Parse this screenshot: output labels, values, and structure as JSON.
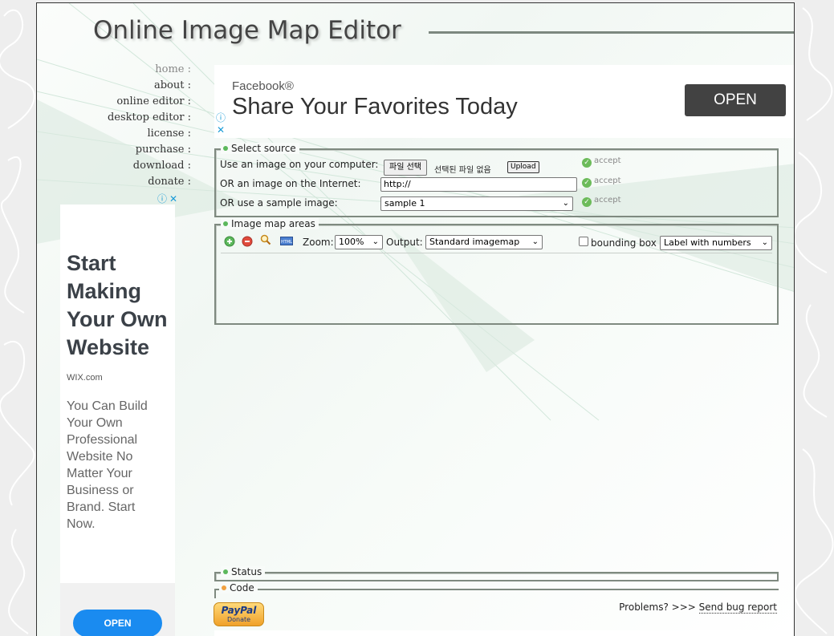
{
  "site": {
    "title": "Online Image Map Editor"
  },
  "nav": [
    {
      "label": "home :"
    },
    {
      "label": "about :"
    },
    {
      "label": "online editor :"
    },
    {
      "label": "desktop editor :"
    },
    {
      "label": "license :"
    },
    {
      "label": "purchase :"
    },
    {
      "label": "download :"
    },
    {
      "label": "donate :"
    }
  ],
  "top_ad": {
    "brand": "Facebook®",
    "headline": "Share Your Favorites Today",
    "cta": "OPEN"
  },
  "side_ad": {
    "headline": "Start Making Your Own Website",
    "source": "WIX.com",
    "body": "You Can Build Your Own Professional Website No Matter Your Business or Brand. Start Now.",
    "cta": "OPEN"
  },
  "select_source": {
    "legend": "Select source",
    "computer": {
      "label": "Use an image on your computer:",
      "file_button": "파일 선택",
      "file_status": "선택된 파일 없음",
      "upload": "Upload",
      "accept": "accept"
    },
    "internet": {
      "label": "OR an image on the Internet:",
      "value": "http://",
      "accept": "accept"
    },
    "sample": {
      "label": "OR use a sample image:",
      "selected": "sample 1",
      "accept": "accept"
    }
  },
  "areas": {
    "legend": "Image map areas",
    "zoom_label": "Zoom:",
    "zoom_value": "100%",
    "output_label": "Output:",
    "output_value": "Standard imagemap",
    "bounding_box": "bounding box",
    "label_mode": "Label with numbers"
  },
  "status": {
    "legend": "Status"
  },
  "code": {
    "legend": "Code"
  },
  "footer": {
    "problems": "Problems? >>>",
    "bug_report": "Send bug report",
    "paypal": "PayPal",
    "donate": "Donate"
  },
  "colors": {
    "accent_green": "#5cb85c",
    "ad_button_dark": "#424242",
    "ad_button_blue": "#1a8bf0",
    "adchoices_blue": "#1a9bd7"
  }
}
